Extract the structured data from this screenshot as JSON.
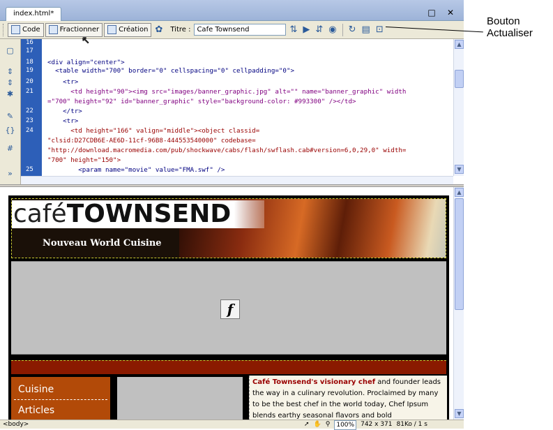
{
  "document": {
    "tab_label": "index.html*",
    "window_controls": "□ ✕"
  },
  "toolbar": {
    "code_label": "Code",
    "split_label": "Fractionner",
    "design_label": "Création",
    "title_label": "Titre :",
    "title_value": "Cafe Townsend",
    "icons": [
      "live-debug-icon",
      "file-management-icon",
      "preview-icon",
      "refresh-icon",
      "view-options-icon",
      "visual-aids-icon"
    ]
  },
  "code": {
    "line_numbers": [
      "16",
      "17",
      "18",
      "19",
      "20",
      "21",
      "",
      "22",
      "23",
      "24",
      "",
      "",
      "",
      "25"
    ],
    "lines": [
      "<div align=\"center\">",
      "  <table width=\"700\" border=\"0\" cellspacing=\"0\" cellpadding=\"0\">",
      "    <tr>",
      "      <td height=\"90\"><img src=\"images/banner_graphic.jpg\" alt=\"\" name=\"banner_graphic\" width",
      "=\"700\" height=\"92\" id=\"banner_graphic\" style=\"background-color: #993300\" /></td>",
      "    </tr>",
      "    <tr>",
      "      <td height=\"166\" valign=\"middle\"><object classid=",
      "\"clsid:D27CDB6E-AE6D-11cf-96B8-444553540000\" codebase=",
      "\"http://download.macromedia.com/pub/shockwave/cabs/flash/swflash.cab#version=6,0,29,0\" width=",
      "\"700\" height=\"150\">",
      "        <param name=\"movie\" value=\"FMA.swf\" />"
    ]
  },
  "design": {
    "logo_cafe": "café",
    "logo_townsend": "TOWNSEND",
    "tagline": "Nouveau World Cuisine",
    "nav": [
      "Cuisine",
      "Articles"
    ],
    "body_bold": "Café Townsend's visionary chef",
    "body_text": " and founder leads the way in a culinary revolution. Proclaimed by many to be the best chef in the world today, Chef Ipsum blends earthy seasonal flavors and bold"
  },
  "status": {
    "tag": "<body>",
    "zoom": "100%",
    "size": "742 x 371",
    "download": "81Ko / 1 s"
  },
  "annotation": {
    "line1": "Bouton",
    "line2": "Actualiser"
  },
  "colors": {
    "accent": "#2d5fb8",
    "brand_red": "#8a1a00",
    "nav_orange": "#b24a08"
  }
}
